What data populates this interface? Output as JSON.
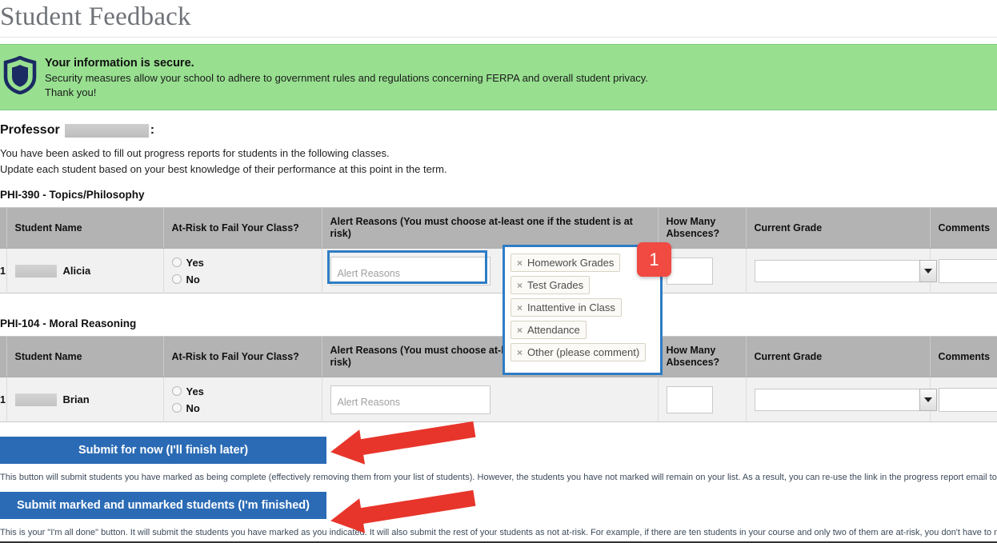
{
  "page": {
    "title": "Student Feedback"
  },
  "security_banner": {
    "icon": "shield-icon",
    "heading": "Your information is secure.",
    "line1": "Security measures allow your school to adhere to government rules and regulations concerning FERPA and overall student privacy.",
    "line2": "Thank you!",
    "background_color": "#98e090"
  },
  "intro": {
    "greeting_prefix": "Professor",
    "greeting_suffix": ":",
    "redacted": true,
    "line1": "You have been asked to fill out progress reports for students in the following classes.",
    "line2": "Update each student based on your best knowledge of their performance at this point in the term."
  },
  "columns": {
    "number": "",
    "student_name": "Student Name",
    "at_risk": "At-Risk to Fail Your Class?",
    "alert_reasons": "Alert Reasons (You must choose at-least one if the student is at risk)",
    "alert_reasons_truncated": "Alert Reasons (You must choose at-le",
    "absences": "How Many Absences?",
    "current_grade": "Current Grade",
    "comments": "Comments"
  },
  "classes": [
    {
      "title": "PHI-390 - Topics/Philosophy",
      "rows": [
        {
          "number": "1",
          "student_first_name": "Alicia",
          "at_risk_options": [
            "Yes",
            "No"
          ],
          "at_risk_selected": "",
          "alert_reasons_placeholder": "Alert Reasons",
          "alert_reasons_value": "",
          "absences_value": "",
          "current_grade_value": "",
          "comments_value": ""
        }
      ]
    },
    {
      "title": "PHI-104 - Moral Reasoning",
      "rows": [
        {
          "number": "1",
          "student_first_name": "Brian",
          "at_risk_options": [
            "Yes",
            "No"
          ],
          "at_risk_selected": "",
          "alert_reasons_placeholder": "Alert Reasons",
          "alert_reasons_value": "",
          "absences_value": "",
          "current_grade_value": "",
          "comments_value": ""
        }
      ]
    }
  ],
  "alert_reason_dropdown": {
    "open": true,
    "options": [
      "Homework Grades",
      "Test Grades",
      "Inattentive in Class",
      "Attendance",
      "Other (please comment)"
    ],
    "remove_glyph": "×",
    "highlight_color": "#2e7cc4"
  },
  "annotations": {
    "badge_label": "1",
    "badge_color": "#f04a43",
    "arrow_color": "#e8352b"
  },
  "actions": {
    "submit_later_label": "Submit for now (I'll finish later)",
    "submit_later_help": "This button will submit students you have marked as being complete (effectively removing them from your list of students). However, the students you have not marked will remain on your list. As a result, you can re-use the link in the progress report email to see the remaining students in your classes. Repeat this process until all students have been marked in some form or fashion.",
    "submit_all_label": "Submit marked and unmarked students (I'm finished)",
    "submit_all_help": "This is your \"I'm all done\" button. It will submit the students you have marked as you indicated. It will also submit the rest of your students as not at-risk. For example, if there are ten students in your course and only two of them are at-risk, you don't have to mark the other eight students and then use this button to mark the remaining students as not at-risk, therefore saving time and effort. Please use this button carefully because with just a single click, it will totally complete your progress report campaign.",
    "button_color": "#2b6bb5"
  }
}
